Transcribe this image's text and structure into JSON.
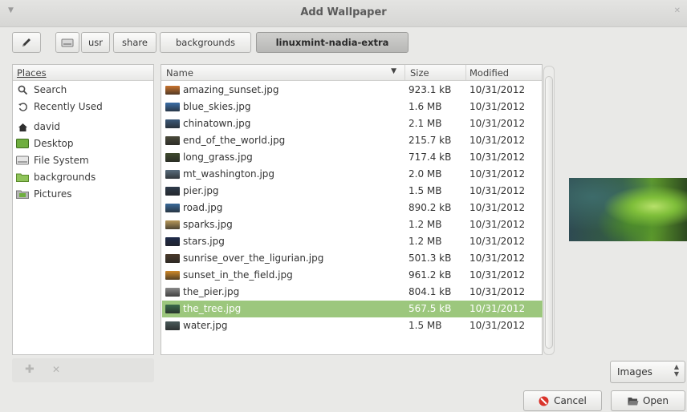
{
  "window": {
    "title": "Add Wallpaper"
  },
  "pathbar": {
    "segments": [
      "usr",
      "share",
      "backgrounds",
      "linuxmint-nadia-extra"
    ]
  },
  "places": {
    "header": "Places",
    "items": [
      {
        "label": "Search",
        "icon": "search-icon"
      },
      {
        "label": "Recently Used",
        "icon": "recent-icon"
      },
      {
        "label": "david",
        "icon": "home-icon"
      },
      {
        "label": "Desktop",
        "icon": "desktop-icon"
      },
      {
        "label": "File System",
        "icon": "drive-icon"
      },
      {
        "label": "backgrounds",
        "icon": "folder-icon"
      },
      {
        "label": "Pictures",
        "icon": "pictures-icon"
      }
    ]
  },
  "files": {
    "columns": {
      "name": "Name",
      "size": "Size",
      "modified": "Modified"
    },
    "rows": [
      {
        "name": "amazing_sunset.jpg",
        "size": "923.1 kB",
        "modified": "10/31/2012",
        "thumb_color": "#c9742e"
      },
      {
        "name": "blue_skies.jpg",
        "size": "1.6 MB",
        "modified": "10/31/2012",
        "thumb_color": "#3b6fa8"
      },
      {
        "name": "chinatown.jpg",
        "size": "2.1 MB",
        "modified": "10/31/2012",
        "thumb_color": "#3d5a7a"
      },
      {
        "name": "end_of_the_world.jpg",
        "size": "215.7 kB",
        "modified": "10/31/2012",
        "thumb_color": "#4a4a3a"
      },
      {
        "name": "long_grass.jpg",
        "size": "717.4 kB",
        "modified": "10/31/2012",
        "thumb_color": "#3f4a2e"
      },
      {
        "name": "mt_washington.jpg",
        "size": "2.0 MB",
        "modified": "10/31/2012",
        "thumb_color": "#5a6e7e"
      },
      {
        "name": "pier.jpg",
        "size": "1.5 MB",
        "modified": "10/31/2012",
        "thumb_color": "#2d3a4a"
      },
      {
        "name": "road.jpg",
        "size": "890.2 kB",
        "modified": "10/31/2012",
        "thumb_color": "#3a6a9a"
      },
      {
        "name": "sparks.jpg",
        "size": "1.2 MB",
        "modified": "10/31/2012",
        "thumb_color": "#b99a5a"
      },
      {
        "name": "stars.jpg",
        "size": "1.2 MB",
        "modified": "10/31/2012",
        "thumb_color": "#1e2a4a"
      },
      {
        "name": "sunrise_over_the_ligurian.jpg",
        "size": "501.3 kB",
        "modified": "10/31/2012",
        "thumb_color": "#4a3a2a"
      },
      {
        "name": "sunset_in_the_field.jpg",
        "size": "961.2 kB",
        "modified": "10/31/2012",
        "thumb_color": "#d08a2a"
      },
      {
        "name": "the_pier.jpg",
        "size": "804.1 kB",
        "modified": "10/31/2012",
        "thumb_color": "#8a8a8a"
      },
      {
        "name": "the_tree.jpg",
        "size": "567.5 kB",
        "modified": "10/31/2012",
        "thumb_color": "#3a6a4a",
        "selected": true
      },
      {
        "name": "water.jpg",
        "size": "1.5 MB",
        "modified": "10/31/2012",
        "thumb_color": "#4a5a5a"
      }
    ]
  },
  "filter": {
    "selected": "Images"
  },
  "buttons": {
    "cancel": "Cancel",
    "open": "Open"
  },
  "colors": {
    "selection": "#9cc77d",
    "cancel_icon": "#d9342b",
    "open_icon": "#4a4a4a"
  }
}
